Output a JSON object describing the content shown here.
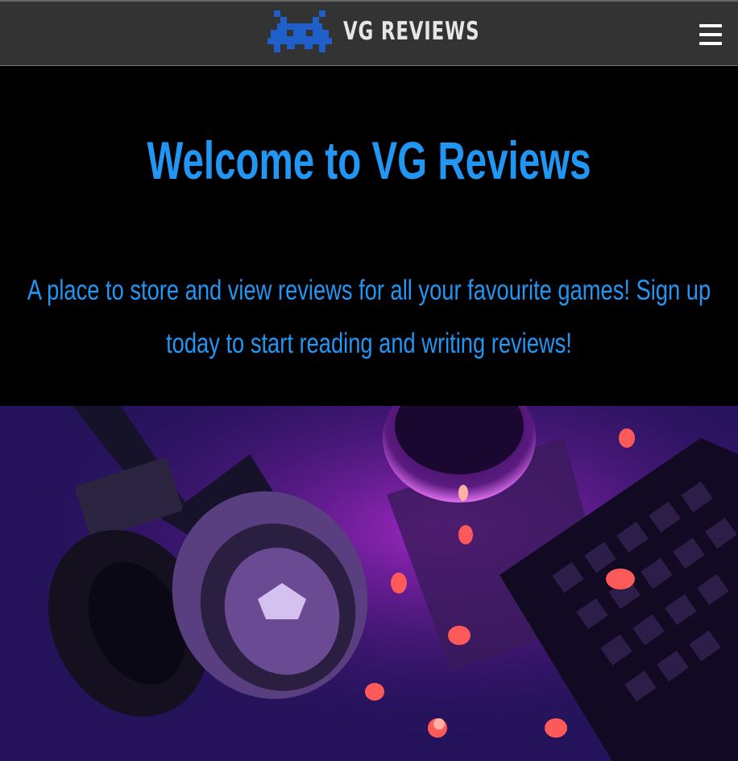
{
  "navbar": {
    "brand_name": "VG REVIEWS",
    "brand_icon": "space-invader-icon",
    "menu_icon": "hamburger-menu-icon"
  },
  "hero": {
    "title": "Welcome to VG Reviews",
    "subtitle": "A place to store and view reviews for all your favourite games! Sign up today to start reading and writing reviews!"
  },
  "image": {
    "subject": "gaming-headset-keyboard-photo"
  },
  "colors": {
    "navbar_bg": "#333333",
    "page_bg": "#000000",
    "accent_blue": "#2196f3",
    "brand_icon_blue": "#1e5fc9"
  }
}
